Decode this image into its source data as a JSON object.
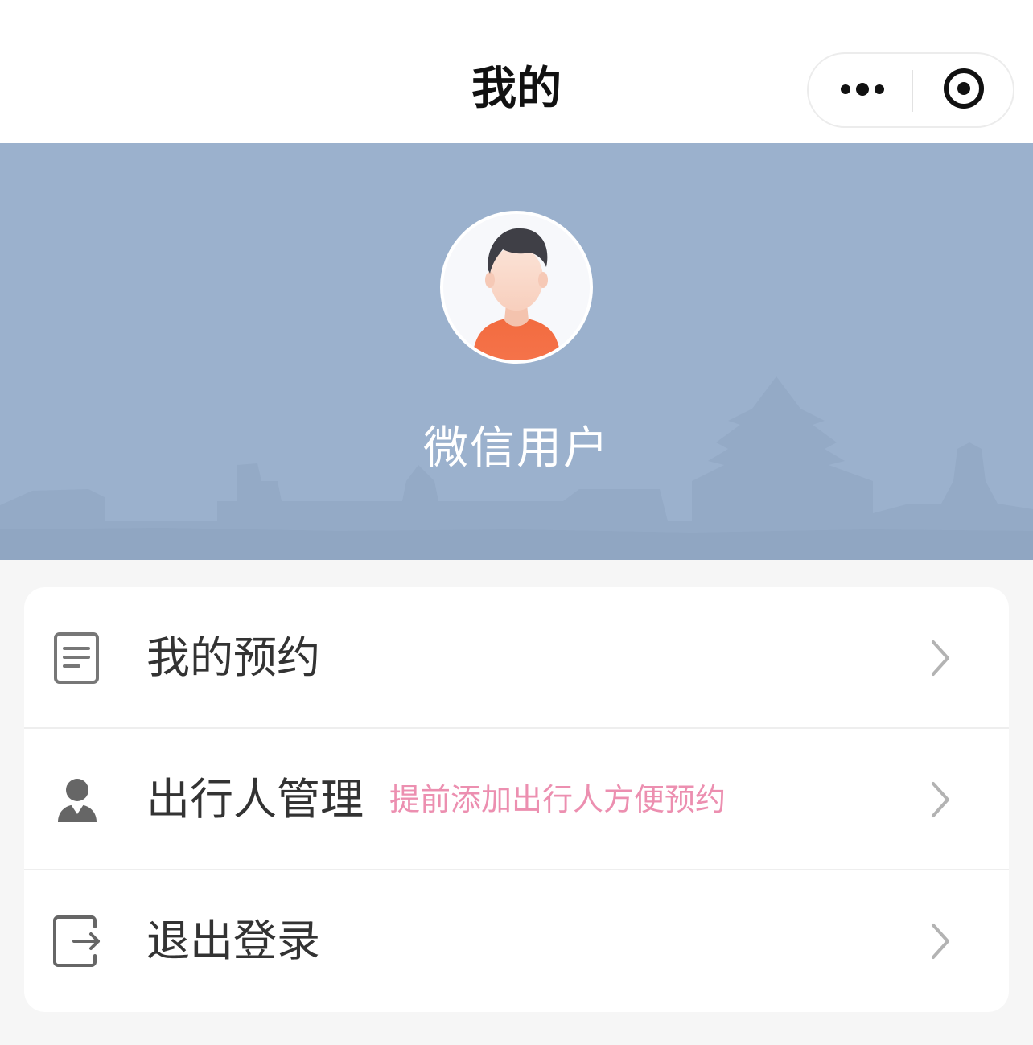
{
  "navbar": {
    "title": "我的",
    "more_icon": "more-dots-icon",
    "close_icon": "target-close-icon"
  },
  "profile": {
    "avatar_icon": "default-user-avatar",
    "username": "微信用户",
    "background_color": "#9bb1cd"
  },
  "menu": {
    "items": [
      {
        "icon": "document-icon",
        "label": "我的预约",
        "hint": ""
      },
      {
        "icon": "person-icon",
        "label": "出行人管理",
        "hint": "提前添加出行人方便预约"
      },
      {
        "icon": "logout-icon",
        "label": "退出登录",
        "hint": ""
      }
    ]
  },
  "colors": {
    "page_background": "#f6f6f6",
    "card_background": "#ffffff",
    "hint_text": "#ec8fb0",
    "label_text": "#333333",
    "chevron": "#b3b3b3"
  }
}
